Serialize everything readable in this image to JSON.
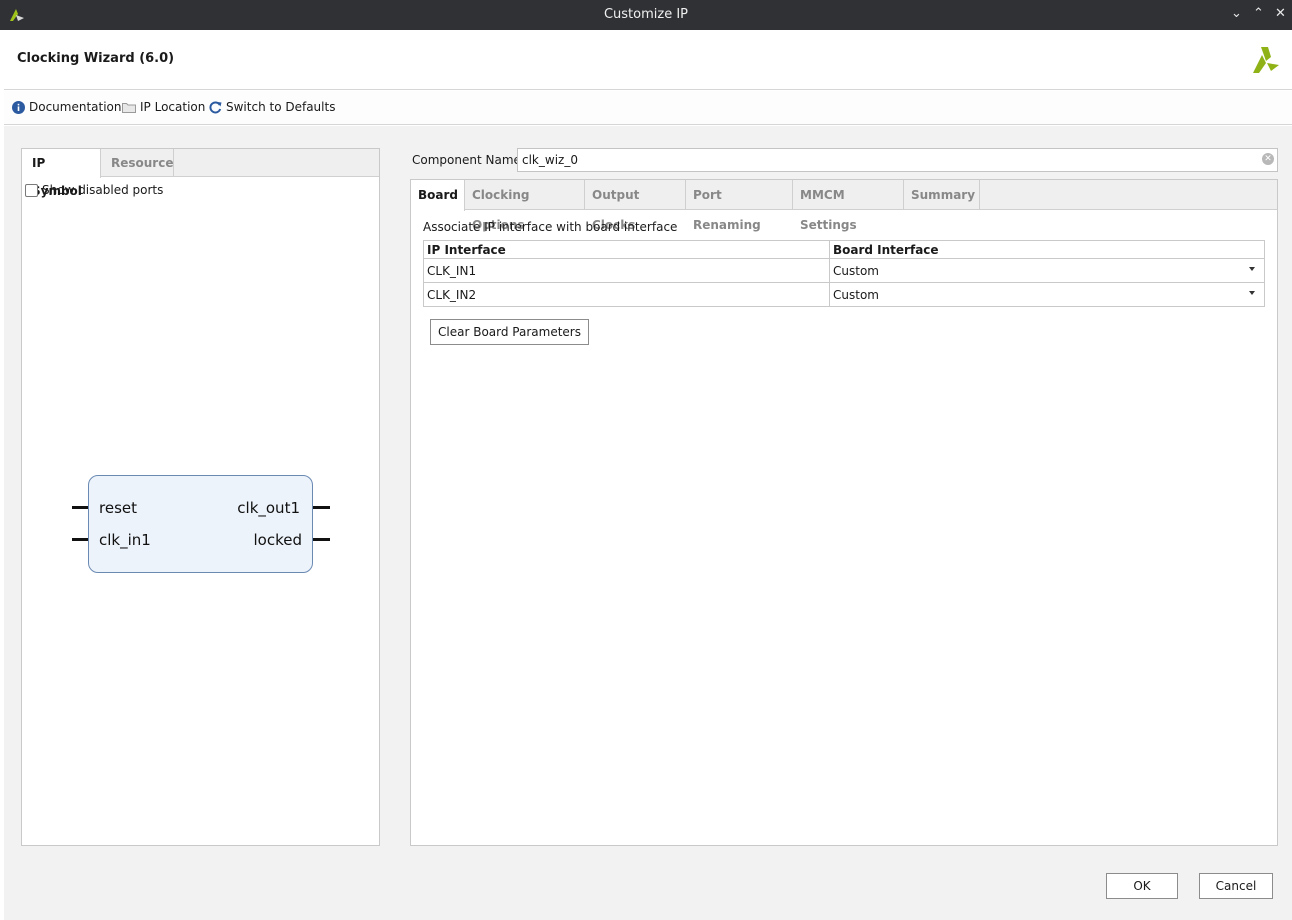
{
  "window": {
    "title": "Customize IP",
    "controls": [
      "⌄",
      "⌃",
      "✕"
    ]
  },
  "header": {
    "title": "Clocking Wizard (6.0)"
  },
  "toolbar": {
    "documentation": "Documentation",
    "ip_location": "IP Location",
    "switch_defaults": "Switch to Defaults"
  },
  "left": {
    "tabs": [
      "IP Symbol",
      "Resource"
    ],
    "show_disabled_ports": "Show disabled ports",
    "symbol": {
      "left_ports": [
        "reset",
        "clk_in1"
      ],
      "right_ports": [
        "clk_out1",
        "locked"
      ]
    }
  },
  "right": {
    "component_name_label": "Component Name",
    "component_name_value": "clk_wiz_0",
    "tabs": [
      "Board",
      "Clocking Options",
      "Output Clocks",
      "Port Renaming",
      "MMCM Settings",
      "Summary"
    ],
    "board": {
      "description": "Associate IP interface with board interface",
      "columns": [
        "IP Interface",
        "Board Interface"
      ],
      "rows": [
        {
          "ip": "CLK_IN1",
          "board": "Custom"
        },
        {
          "ip": "CLK_IN2",
          "board": "Custom"
        }
      ],
      "clear_button": "Clear Board Parameters"
    }
  },
  "footer": {
    "ok": "OK",
    "cancel": "Cancel"
  },
  "colors": {
    "titlebar": "#2f3135",
    "logo": "#8fb316",
    "symbol_fill": "#edf3fb",
    "symbol_border": "#6b8ab3",
    "info_icon": "#2c5aa0"
  }
}
